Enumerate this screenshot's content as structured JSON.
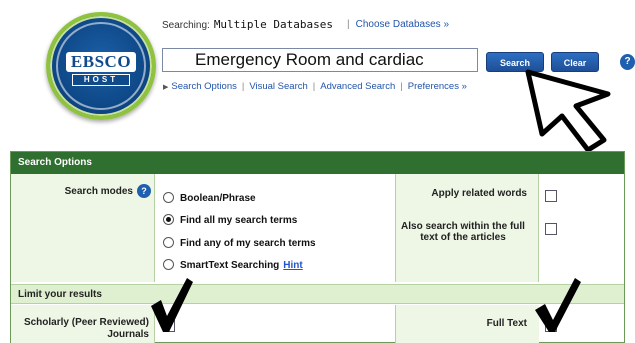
{
  "logo": {
    "word": "EBSCO",
    "sub": "HOST"
  },
  "header": {
    "searching_label": "Searching:",
    "searching_value": "Multiple Databases",
    "choose_link": "Choose Databases »",
    "search_query": "Emergency Room and cardiac",
    "search_button": "Search",
    "clear_button": "Clear",
    "help": "?",
    "links": [
      "Search Options",
      "Visual Search",
      "Advanced Search",
      "Preferences »"
    ]
  },
  "panel": {
    "title": "Search Options",
    "search_modes_label": "Search modes",
    "help": "?",
    "modes": [
      {
        "label": "Boolean/Phrase",
        "selected": false
      },
      {
        "label": "Find all my search terms",
        "selected": true
      },
      {
        "label": "Find any of my search terms",
        "selected": false
      },
      {
        "label": "SmartText Searching",
        "selected": false
      }
    ],
    "hint_link": "Hint",
    "apply_related_words": "Apply related words",
    "also_search_fulltext": "Also search within the full text of the articles",
    "limit_results": "Limit your results",
    "scholarly_label": "Scholarly (Peer Reviewed) Journals",
    "full_text_label": "Full Text"
  },
  "colors": {
    "header_green": "#2f6f2f",
    "panel_bg": "#eef7e6",
    "button_blue": "#1f4f96",
    "link_blue": "#2255aa"
  },
  "icons": [
    "ebsco-host-logo",
    "help-icon",
    "mouse-pointer-icon",
    "checkmark-icon"
  ]
}
